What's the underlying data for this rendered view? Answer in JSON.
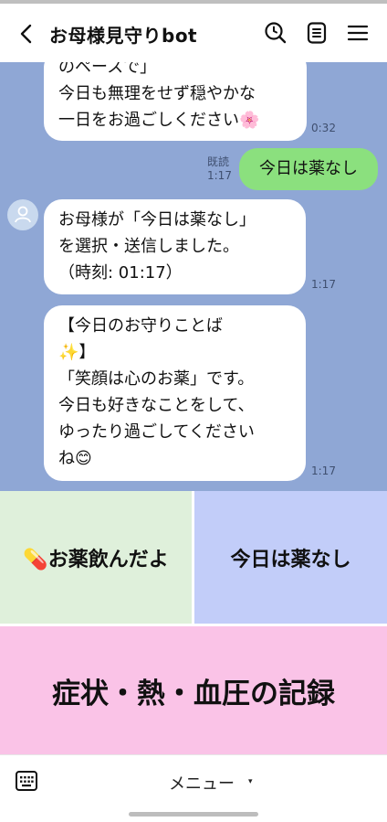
{
  "header": {
    "title": "お母様見守りbot",
    "back_icon": "chevron-left-icon",
    "icons": [
      "search-icon",
      "notes-icon",
      "menu-icon"
    ]
  },
  "chat": {
    "messages": [
      {
        "lines": [
          "のペースで」",
          "今日も無理をせず穏やかな",
          "一日をお過ごしください🌸"
        ],
        "time": "0:32"
      },
      {
        "text": "今日は薬なし",
        "read": "既読",
        "time": "1:17"
      },
      {
        "lines": [
          "お母様が「今日は薬なし」",
          "を選択・送信しました。",
          "（時刻: 01:17）"
        ],
        "time": "1:17"
      },
      {
        "lines": [
          "【今日のお守りことば",
          "✨】",
          "「笑顔は心のお薬」です。",
          "今日も好きなことをして、",
          "ゆったり過ごしてください",
          "ね😊"
        ],
        "time": "1:17"
      }
    ]
  },
  "rich_menu": {
    "buttons": [
      {
        "label": "💊お薬飲んだよ",
        "color": "#dff0db"
      },
      {
        "label": "今日は薬なし",
        "color": "#c2cdf9"
      },
      {
        "label": "症状・熱・血圧の記録",
        "color": "#fac3e7"
      }
    ]
  },
  "bottom": {
    "menu_label": "メニュー",
    "caret": "▾",
    "keyboard_icon": "keyboard-icon"
  },
  "colors": {
    "chat_bg": "#8fa7d5",
    "sent_bubble": "#8be07e",
    "received_bubble": "#ffffff"
  }
}
